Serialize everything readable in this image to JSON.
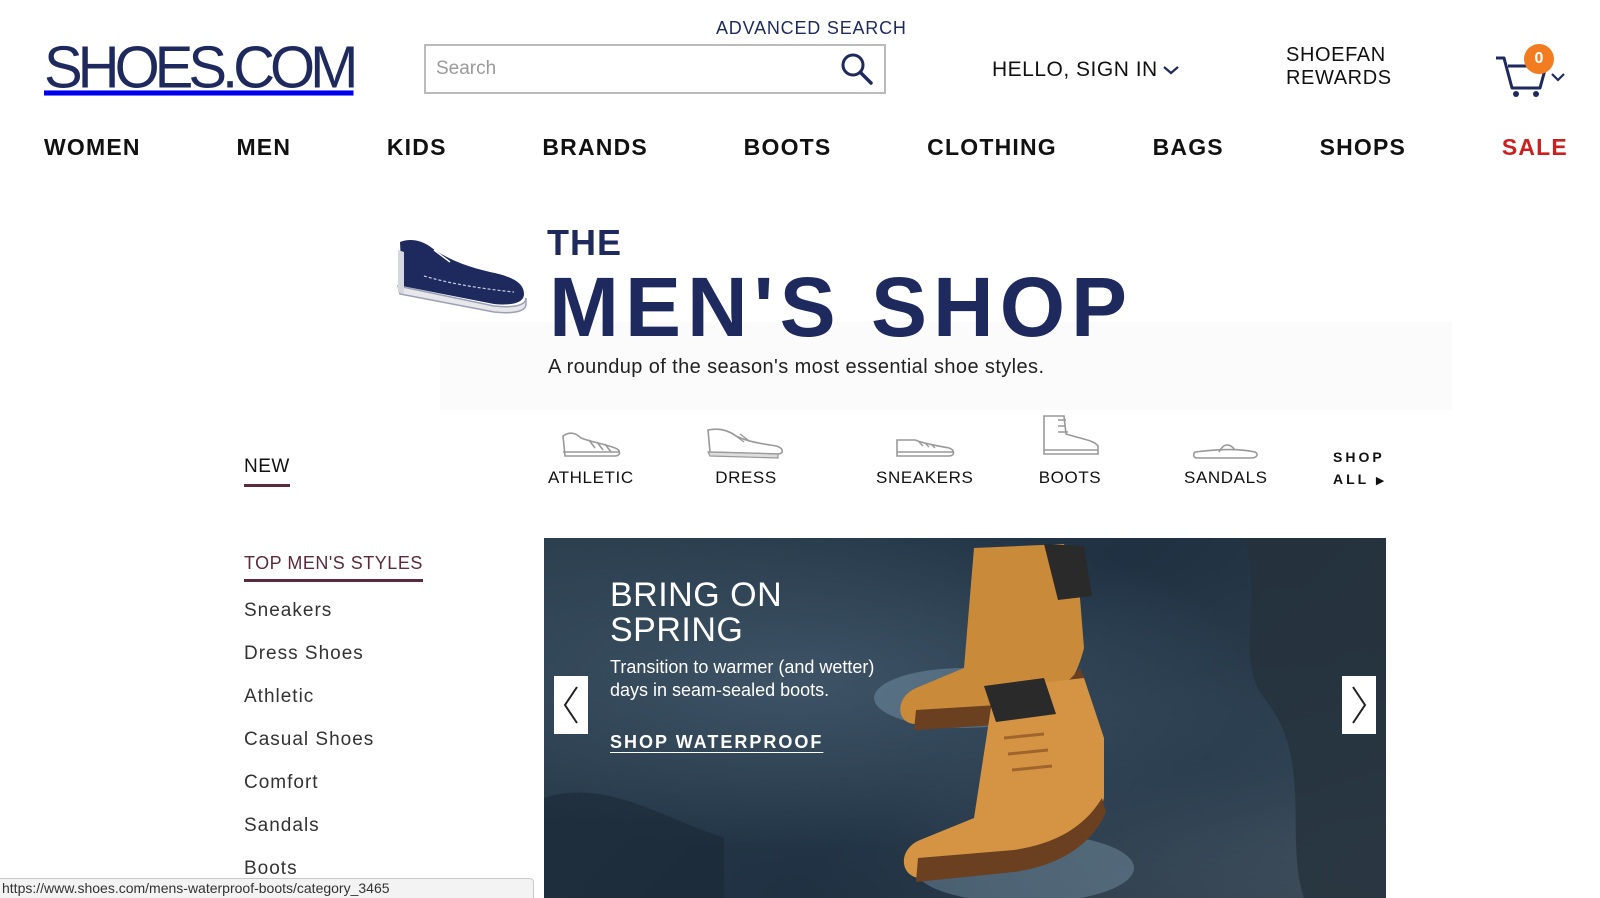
{
  "header": {
    "logo": "SHOES.COM",
    "advanced_search": "ADVANCED SEARCH",
    "search_placeholder": "Search",
    "signin": "HELLO, SIGN IN",
    "rewards_line1": "SHOEFAN",
    "rewards_line2": "REWARDS",
    "cart_count": "0"
  },
  "nav": {
    "items": [
      "WOMEN",
      "MEN",
      "KIDS",
      "BRANDS",
      "BOOTS",
      "CLOTHING",
      "BAGS",
      "SHOPS",
      "SALE"
    ],
    "sale_color": "#cc1f1f"
  },
  "hero": {
    "eyebrow": "THE",
    "title": "MEN'S SHOP",
    "subtitle": "A roundup of the season's most essential shoe styles."
  },
  "categories": {
    "items": [
      {
        "label": "ATHLETIC",
        "icon": "athletic-shoe-icon"
      },
      {
        "label": "DRESS",
        "icon": "dress-shoe-icon"
      },
      {
        "label": "SNEAKERS",
        "icon": "sneaker-icon"
      },
      {
        "label": "BOOTS",
        "icon": "boot-icon"
      },
      {
        "label": "SANDALS",
        "icon": "sandal-icon"
      }
    ],
    "shop_all_line1": "SHOP",
    "shop_all_line2": "ALL"
  },
  "sidebar": {
    "new_label": "NEW",
    "heading": "TOP MEN'S STYLES",
    "items": [
      "Sneakers",
      "Dress Shoes",
      "Athletic",
      "Casual Shoes",
      "Comfort",
      "Sandals",
      "Boots"
    ]
  },
  "banner": {
    "title_line1": "BRING ON",
    "title_line2": "SPRING",
    "desc_line1": "Transition to warmer (and wetter)",
    "desc_line2": "days in seam-sealed boots.",
    "cta": "SHOP WATERPROOF"
  },
  "statusbar": {
    "url": "https://www.shoes.com/mens-waterproof-boots/category_3465"
  },
  "colors": {
    "brand_navy": "#1e2a5e",
    "accent_orange": "#f47c20",
    "sidebar_accent": "#5a2b3c"
  }
}
